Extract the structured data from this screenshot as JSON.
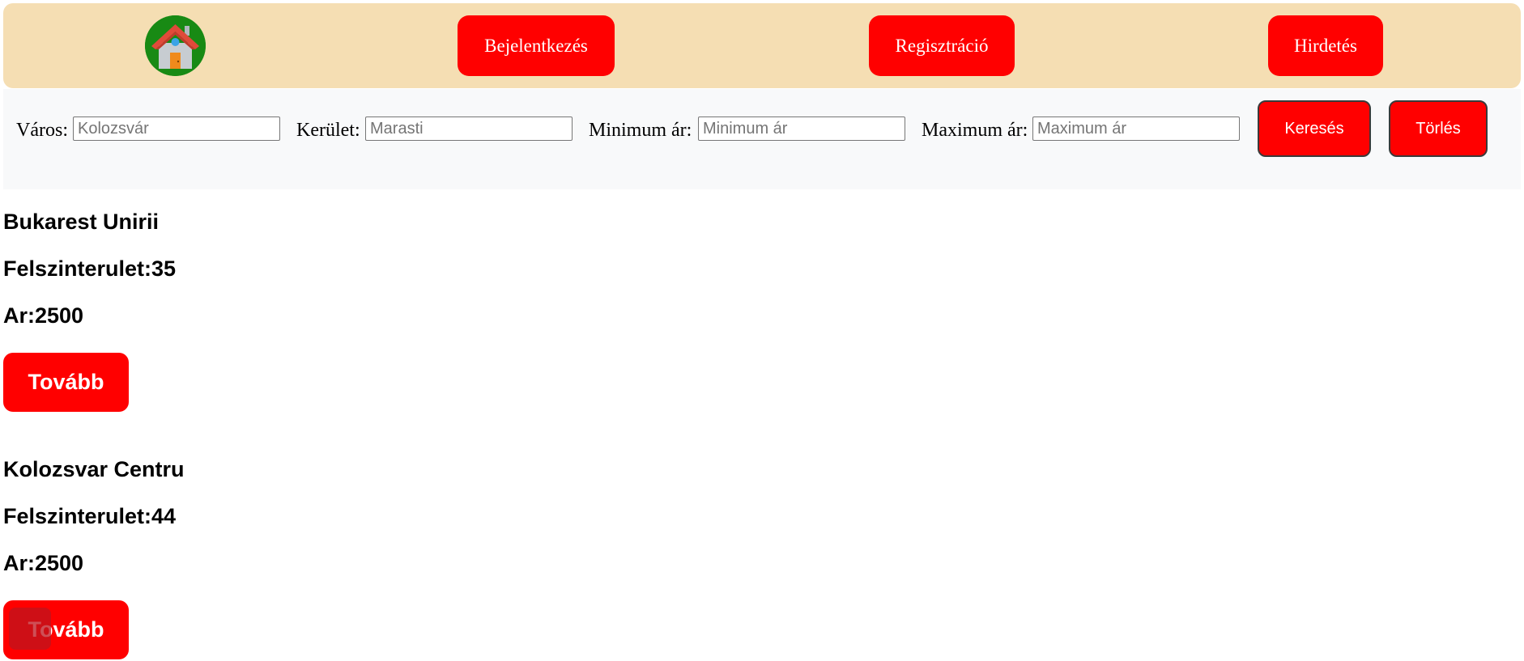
{
  "nav": {
    "logo_icon": "house-icon",
    "login_label": "Bejelentkezés",
    "register_label": "Regisztráció",
    "ad_label": "Hirdetés"
  },
  "search": {
    "city_label": "Város:",
    "city_placeholder": "Kolozsvár",
    "district_label": "Kerület:",
    "district_placeholder": "Marasti",
    "min_price_label": "Minimum ár:",
    "min_price_placeholder": "Minimum ár",
    "max_price_label": "Maximum ár:",
    "max_price_placeholder": "Maximum ár",
    "search_label": "Keresés",
    "clear_label": "Törlés"
  },
  "listings": [
    {
      "title": "Bukarest Unirii",
      "area": "Felszinterulet:35",
      "price": "Ar:2500",
      "more_label": "Tovább"
    },
    {
      "title": "Kolozsvar Centru",
      "area": "Felszinterulet:44",
      "price": "Ar:2500",
      "more_label": "Tovább"
    }
  ],
  "colors": {
    "header_bg": "#f5deb3",
    "search_bg": "#f8f9fa",
    "accent": "#ff0000",
    "logo_bg": "#188a14"
  }
}
